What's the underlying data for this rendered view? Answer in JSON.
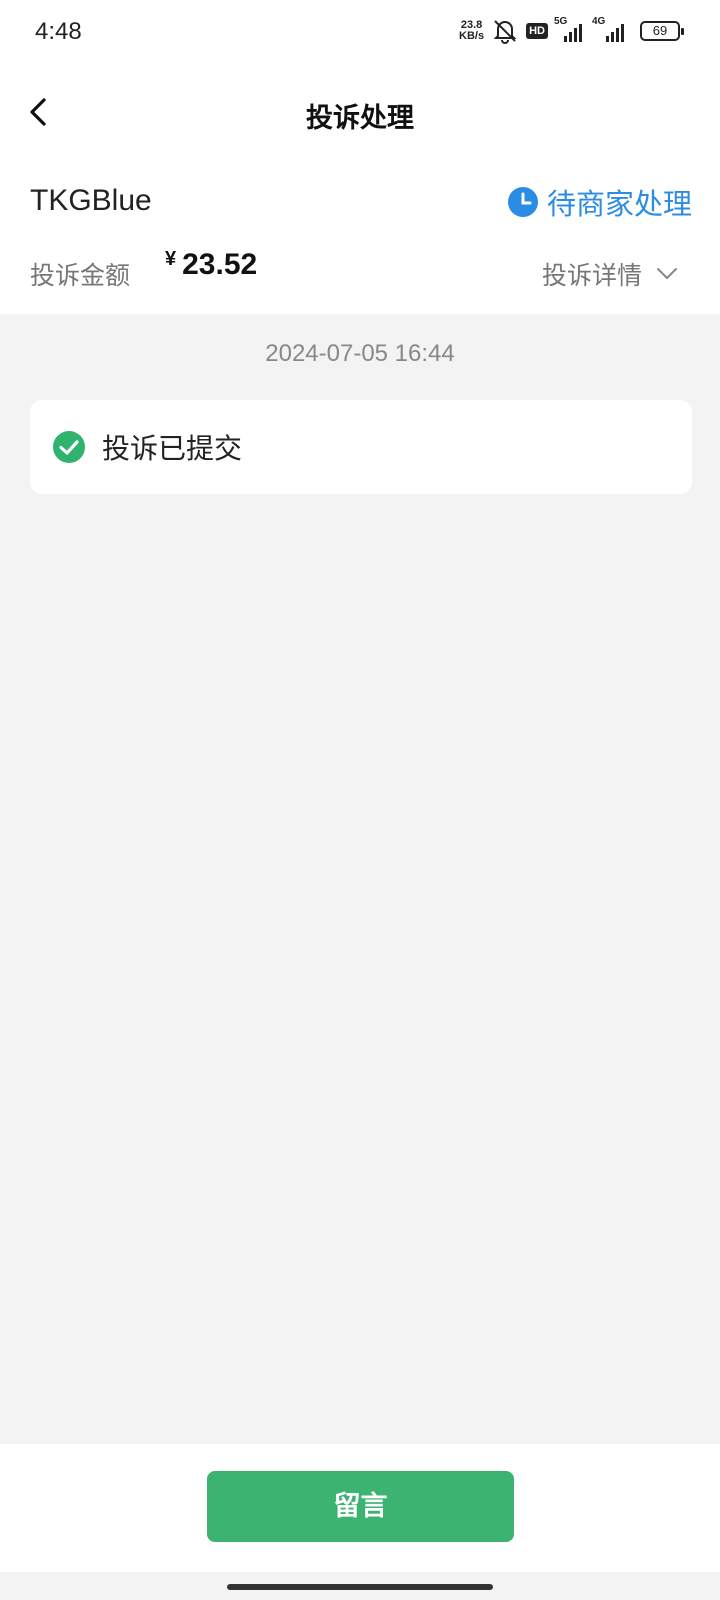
{
  "status_bar": {
    "time": "4:48",
    "net_speed_value": "23.8",
    "net_speed_unit": "KB/s",
    "hd_label": "HD",
    "signal1_tag": "5G",
    "signal2_tag": "4G",
    "battery_level": "69"
  },
  "header": {
    "title": "投诉处理",
    "back_icon": "chevron-left-icon"
  },
  "complaint": {
    "merchant": "TKGBlue",
    "status": "待商家处理",
    "status_color": "#2b8ce6",
    "amount_label": "投诉金额",
    "currency": "¥",
    "amount": "23.52",
    "detail_label": "投诉详情"
  },
  "timeline": {
    "timestamp": "2024-07-05 16:44",
    "event": "投诉已提交",
    "event_icon_color": "#2fb36d"
  },
  "footer": {
    "reply_label": "留言",
    "button_color": "#3cb371"
  }
}
